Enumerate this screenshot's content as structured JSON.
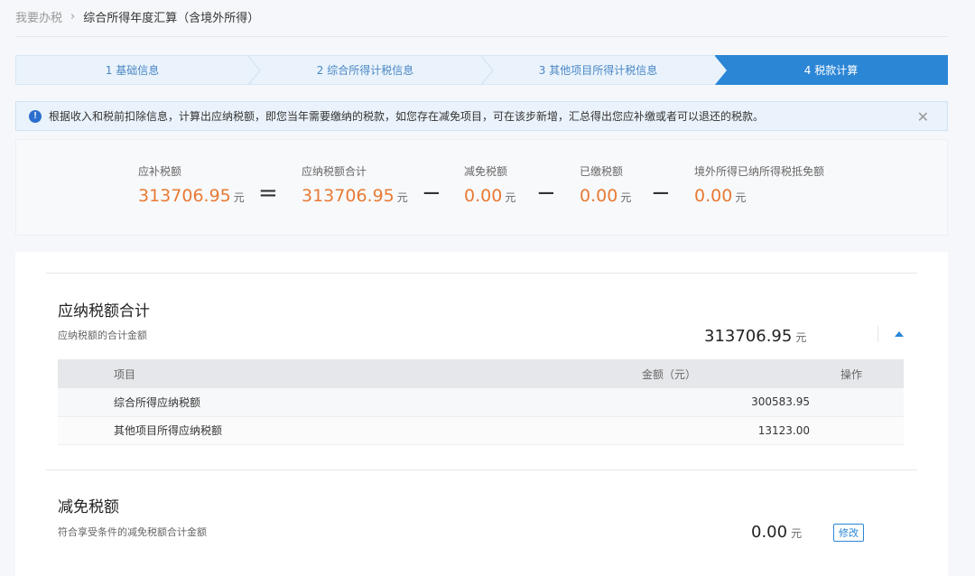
{
  "breadcrumb": {
    "home": "我要办税",
    "current": "综合所得年度汇算（含境外所得）"
  },
  "steps": [
    {
      "label": "1 基础信息"
    },
    {
      "label": "2 综合所得计税信息"
    },
    {
      "label": "3 其他项目所得计税信息"
    },
    {
      "label": "4 税款计算"
    }
  ],
  "notice": {
    "text": "根据收入和税前扣除信息，计算出应纳税额，即您当年需要缴纳的税款，如您存在减免项目，可在该步新增，汇总得出您应补缴或者可以退还的税款。",
    "close": "✕"
  },
  "summary": {
    "unit": "元",
    "items": [
      {
        "label": "应补税额",
        "value": "313706.95"
      },
      {
        "label": "应纳税额合计",
        "value": "313706.95"
      },
      {
        "label": "减免税额",
        "value": "0.00"
      },
      {
        "label": "已缴税额",
        "value": "0.00"
      },
      {
        "label": "境外所得已纳所得税抵免额",
        "value": "0.00"
      }
    ],
    "ops": [
      "=",
      "−",
      "−",
      "−"
    ]
  },
  "tax_total": {
    "title": "应纳税额合计",
    "desc": "应纳税额的合计金额",
    "amount": "313706.95",
    "unit": "元",
    "table": {
      "headers": [
        "项目",
        "金额（元）",
        "操作"
      ],
      "rows": [
        {
          "name": "综合所得应纳税额",
          "amount": "300583.95"
        },
        {
          "name": "其他项目所得应纳税额",
          "amount": "13123.00"
        }
      ]
    }
  },
  "reduction": {
    "title": "减免税额",
    "desc": "符合享受条件的减免税额合计金额",
    "amount": "0.00",
    "unit": "元",
    "edit_label": "修改"
  },
  "colors": {
    "accent": "#2b86d6",
    "amount_orange": "#e87a35"
  }
}
